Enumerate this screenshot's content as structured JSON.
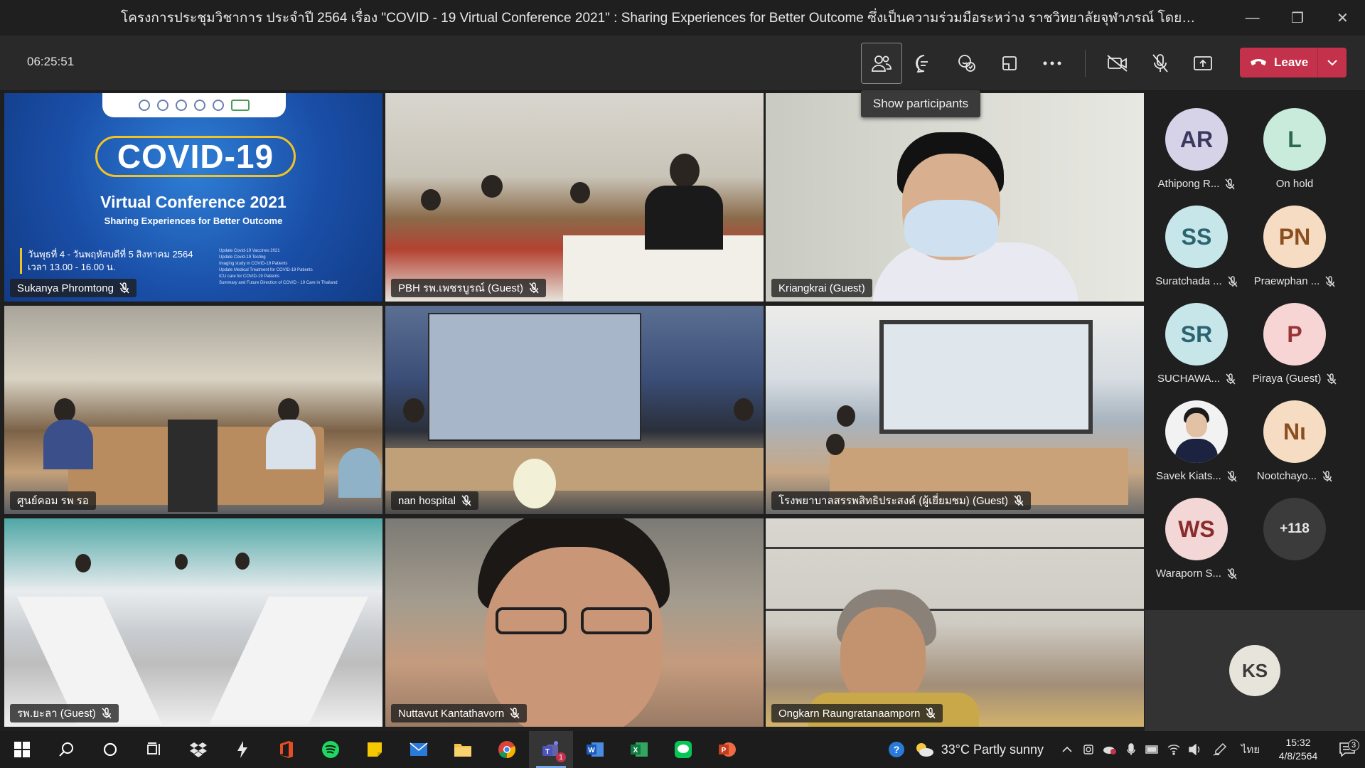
{
  "window": {
    "title": "โครงการประชุมวิชาการ ประจำปี 2564 เรื่อง \"COVID - 19 Virtual Conference 2021\" : Sharing Experiences for Better Outcome ซึ่งเป็นความร่วมมือระหว่าง ราชวิทยาลัยจุฬาภรณ์ โดยคณะแพทยศาสตร์และการสาธารณ...",
    "minimize": "—",
    "maximize": "❐",
    "close": "✕"
  },
  "toolbar": {
    "timer": "06:25:51",
    "leave_label": "Leave",
    "tooltip": "Show participants"
  },
  "slide": {
    "title": "COVID-19",
    "subtitle": "Virtual Conference 2021",
    "tagline": "Sharing Experiences for Better Outcome",
    "date_line1": "วันพุธที่ 4 - วันพฤหัสบดีที่ 5 สิงหาคม 2564",
    "date_line2": "เวลา 13.00 - 16.00 น.",
    "topics": [
      "Update Covid-19 Vaccines 2021",
      "Update Covid-19 Testing",
      "Imaging study in COVID-19 Patients",
      "Update Medical Treatment for COVID-19 Patients",
      "ICU care for COVID-19 Patients",
      "Summary and Future Direction of COVID - 19 Care in Thailand"
    ]
  },
  "tiles": [
    {
      "name": "Sukanya Phromtong",
      "muted": true
    },
    {
      "name": "PBH รพ.เพชรบูรณ์ (Guest)",
      "muted": true
    },
    {
      "name": "Kriangkrai (Guest)",
      "muted": false
    },
    {
      "name": "ศูนย์คอม รพ รอ",
      "muted": false
    },
    {
      "name": "nan hospital",
      "muted": true
    },
    {
      "name": "โรงพยาบาลสรรพสิทธิประสงค์ (ผู้เยี่ยมชม) (Guest)",
      "muted": true
    },
    {
      "name": "รพ.ยะลา (Guest)",
      "muted": true
    },
    {
      "name": "Nuttavut Kantathavorn",
      "muted": true
    },
    {
      "name": "Ongkarn Raungratanaamporn",
      "muted": true
    }
  ],
  "participants": [
    {
      "initials": "AR",
      "name": "Athipong R...",
      "bg": "#d6d3e8",
      "fg": "#3b3860",
      "muted": true
    },
    {
      "initials": "L",
      "name": "On hold",
      "bg": "#c8ebdc",
      "fg": "#2c6a50",
      "muted": false
    },
    {
      "initials": "SS",
      "name": "Suratchada ...",
      "bg": "#c6e6ea",
      "fg": "#2b6470",
      "muted": true
    },
    {
      "initials": "PN",
      "name": "Praewphan ...",
      "bg": "#f5dcc2",
      "fg": "#8a4e1f",
      "muted": true
    },
    {
      "initials": "SR",
      "name": "SUCHAWA...",
      "bg": "#c6e6ea",
      "fg": "#2b6470",
      "muted": true
    },
    {
      "initials": "P",
      "name": "Piraya (Guest)",
      "bg": "#f7d5d5",
      "fg": "#9a3434",
      "muted": true
    },
    {
      "initials": "",
      "name": "Savek Kiats...",
      "bg": "#f2f2f2",
      "fg": "#333",
      "muted": true
    },
    {
      "initials": "Nι",
      "name": "Nootchayo...",
      "bg": "#f5dcc2",
      "fg": "#8a4e1f",
      "muted": true
    },
    {
      "initials": "WS",
      "name": "Waraporn S...",
      "bg": "#f3d6d6",
      "fg": "#8a2b2b",
      "muted": true
    }
  ],
  "more_participants": "+118",
  "self_initials": "KS",
  "taskbar": {
    "weather": "33°C  Partly sunny",
    "time": "15:32",
    "date": "4/8/2564",
    "lang": "ไทย",
    "notif_count": "3",
    "teams_badge": "1"
  },
  "colors": {
    "leave": "#c4314b",
    "selected_outline": "#a9a2e8",
    "background": "#1f1f1f"
  }
}
